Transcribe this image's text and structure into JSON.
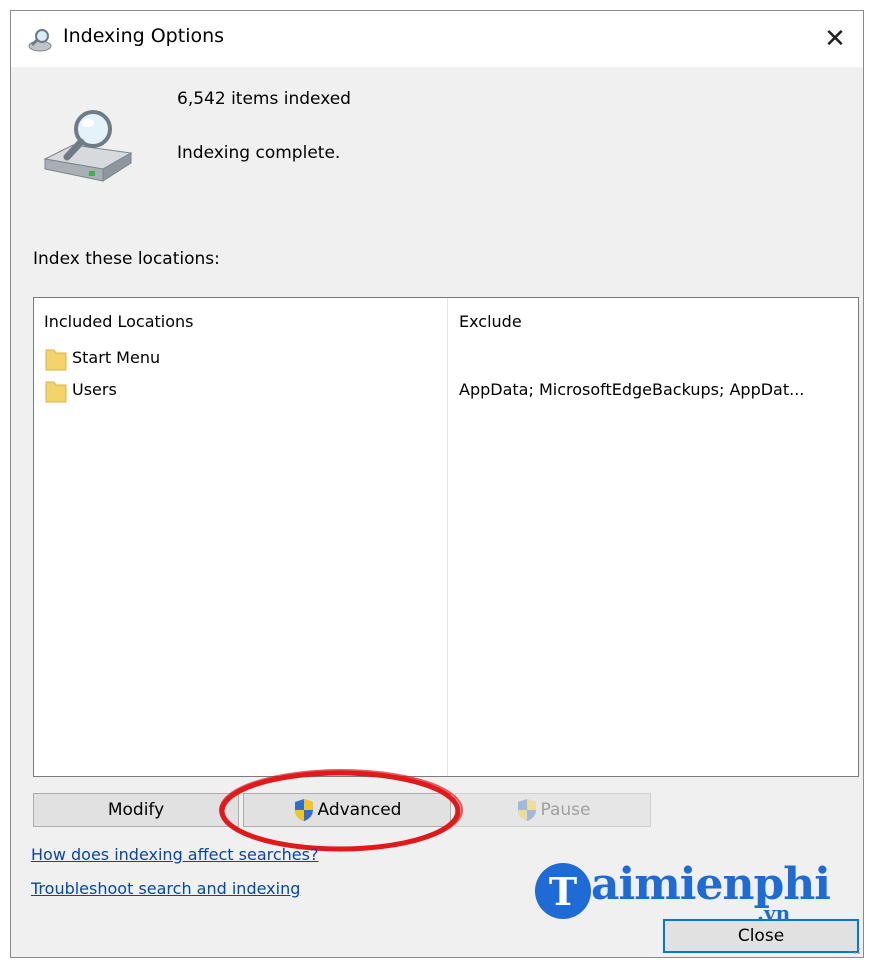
{
  "window": {
    "title": "Indexing Options",
    "close_glyph": "✕"
  },
  "status": {
    "items_indexed": "6,542 items indexed",
    "indexing_state": "Indexing complete.",
    "icon": "drive-magnifier-icon"
  },
  "locations": {
    "label": "Index these locations:",
    "columns": {
      "included": "Included Locations",
      "exclude": "Exclude"
    },
    "rows": [
      {
        "name": "Start Menu",
        "exclude": "",
        "icon": "folder-icon"
      },
      {
        "name": "Users",
        "exclude": "AppData; MicrosoftEdgeBackups; AppDat...",
        "icon": "folder-icon"
      }
    ]
  },
  "buttons": {
    "modify": "Modify",
    "advanced": "Advanced",
    "pause": "Pause",
    "close": "Close"
  },
  "links": {
    "how_indexing": "How does indexing affect searches?",
    "troubleshoot": "Troubleshoot search and indexing"
  },
  "watermark": {
    "letter": "T",
    "text": "aimienphi",
    "suffix": ".vn"
  },
  "colors": {
    "dialog_bg": "#f0f0f0",
    "link": "#0645ad",
    "focus_border": "#0078d7",
    "highlight_ring": "#e0191b",
    "watermark": "#1f6bd6",
    "folder": "#f4d36b"
  }
}
